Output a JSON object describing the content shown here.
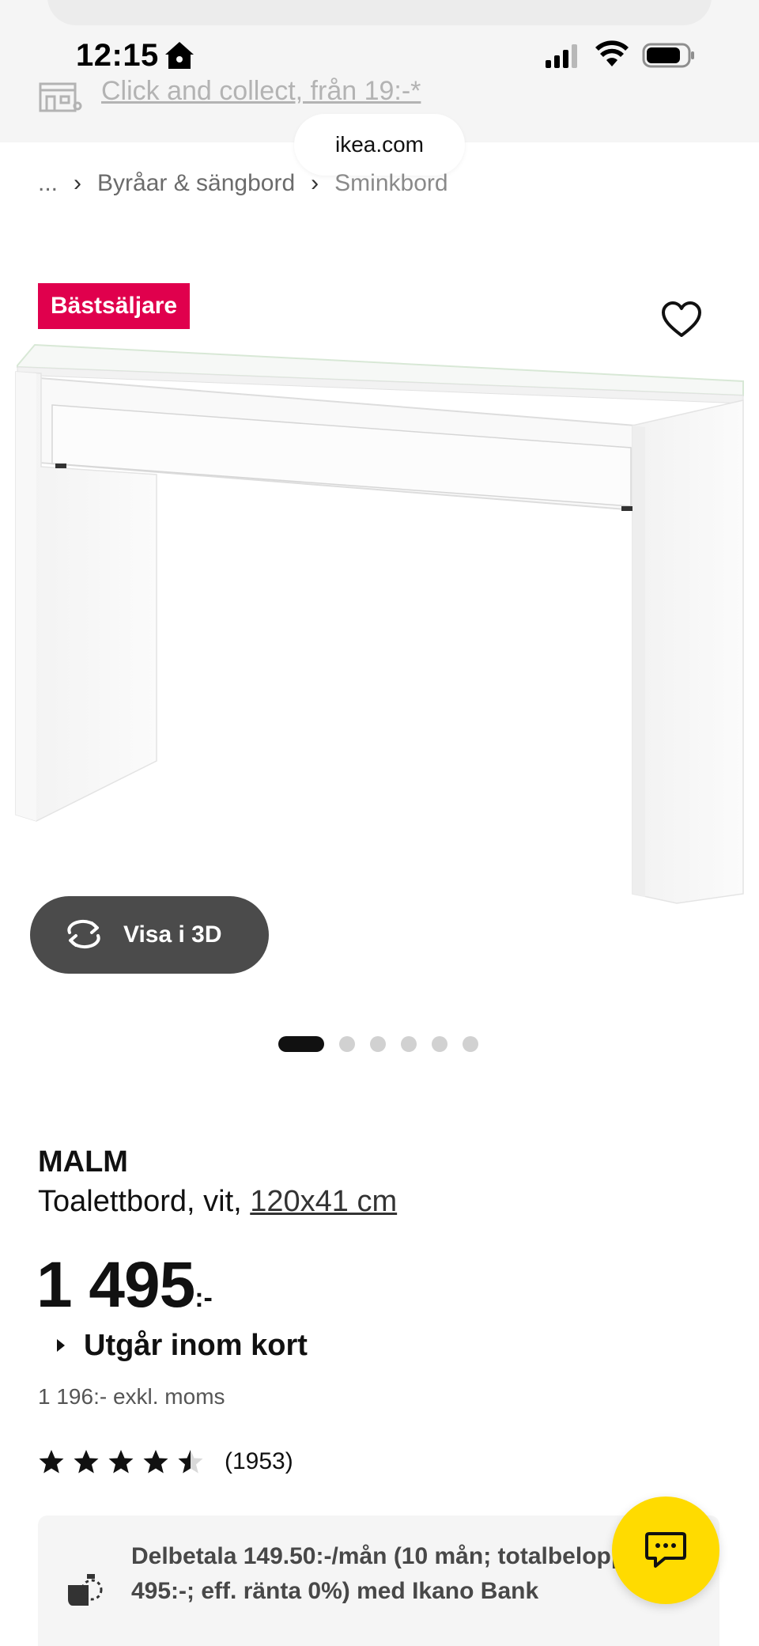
{
  "status_bar": {
    "time": "12:15"
  },
  "top_bar": {
    "click_collect": "Click and collect, från 19:-*",
    "url": "ikea.com"
  },
  "breadcrumb": {
    "items": [
      "...",
      "Byråar & sängbord",
      "Sminkbord"
    ]
  },
  "product": {
    "badge": "Bästsäljare",
    "view_3d_label": "Visa i 3D",
    "image_count": 6,
    "active_image": 1,
    "name": "MALM",
    "description": "Toalettbord, vit,",
    "dimensions": "120x41 cm",
    "price": "1 495",
    "price_suffix": ":-",
    "availability": "Utgår inom kort",
    "price_ex_vat": "1 196:- exkl. moms",
    "rating": 4.5,
    "rating_max": 5,
    "review_count": "(1953)"
  },
  "financing": {
    "text": "Delbetala 149.50:-/mån (10 mån; totalbelopp 1 495:-; eff. ränta 0%) med Ikano Bank"
  },
  "icons": {
    "home": "home-icon",
    "signal": "cellular-signal-icon",
    "wifi": "wifi-icon",
    "battery": "battery-icon",
    "store": "store-icon",
    "favorite": "heart-icon",
    "rotate": "rotate-3d-icon",
    "finance": "piggy-bank-icon",
    "chat": "chat-icon"
  },
  "colors": {
    "badge": "#e0004d",
    "chat_button": "#ffdb00",
    "view3d_button": "#4b4b4b"
  }
}
